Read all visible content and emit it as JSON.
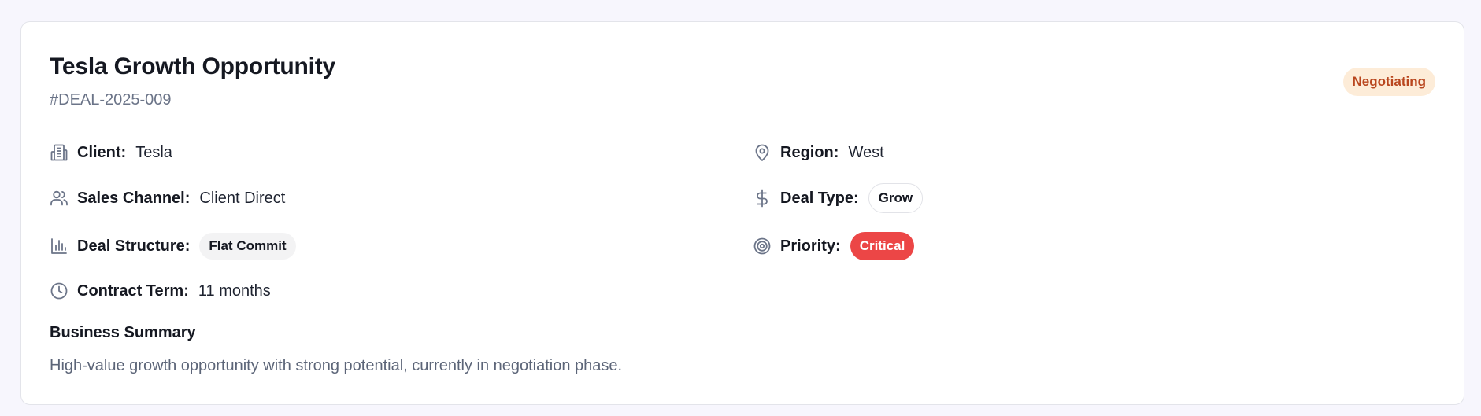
{
  "deal": {
    "title": "Tesla Growth Opportunity",
    "id": "#DEAL-2025-009",
    "status": "Negotiating"
  },
  "fields": {
    "client": {
      "label": "Client:",
      "value": "Tesla",
      "icon": "building-icon"
    },
    "region": {
      "label": "Region:",
      "value": "West",
      "icon": "map-pin-icon"
    },
    "sales_channel": {
      "label": "Sales Channel:",
      "value": "Client Direct",
      "icon": "users-icon"
    },
    "deal_type": {
      "label": "Deal Type:",
      "value": "Grow",
      "icon": "dollar-icon"
    },
    "deal_structure": {
      "label": "Deal Structure:",
      "value": "Flat Commit",
      "icon": "bar-chart-icon"
    },
    "priority": {
      "label": "Priority:",
      "value": "Critical",
      "icon": "target-icon"
    },
    "contract_term": {
      "label": "Contract Term:",
      "value": "11 months",
      "icon": "clock-icon"
    }
  },
  "summary": {
    "heading": "Business Summary",
    "text": "High-value growth opportunity with strong potential, currently in negotiation phase."
  },
  "colors": {
    "status_badge_bg": "#fdecd8",
    "status_badge_text": "#b9461e",
    "priority_critical": "#ec4646",
    "icon_gray": "#6b7488"
  }
}
